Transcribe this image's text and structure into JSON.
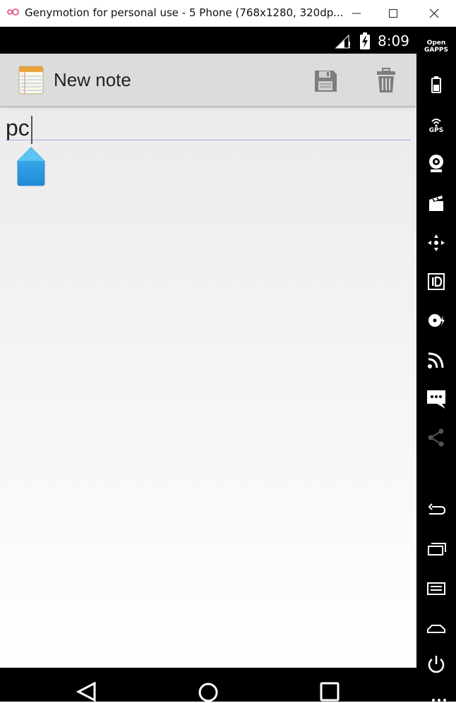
{
  "window": {
    "title": "Genymotion for personal use - 5 Phone (768x1280, 320dp...",
    "minimize_icon": "minimize-icon",
    "maximize_icon": "maximize-icon",
    "close_icon": "close-icon"
  },
  "status_bar": {
    "time": "8:09",
    "signal_icon": "signal-icon",
    "battery_icon": "battery-charging-icon"
  },
  "action_bar": {
    "title": "New note",
    "app_icon": "notepad-icon",
    "save_icon": "save-icon",
    "delete_icon": "trash-icon"
  },
  "editor": {
    "text": "pc",
    "underline_color": "#a9a9e8",
    "handle_color": "#2a9be0"
  },
  "nav_bar": {
    "back_icon": "back-icon",
    "home_icon": "home-icon",
    "recents_icon": "recents-icon"
  },
  "side_panel": {
    "open_gapps_line1": "Open",
    "open_gapps_line2": "GAPPS",
    "gps_label": "GPS",
    "items": [
      "battery-icon",
      "gps-icon",
      "webcam-icon",
      "screencast-icon",
      "dpad-icon",
      "device-id-icon",
      "disk-io-icon",
      "network-icon",
      "sms-icon",
      "share-icon",
      "back-icon",
      "recents-icon",
      "menu-icon",
      "home-icon",
      "power-icon"
    ]
  },
  "colors": {
    "action_bar": "#dcdcdc",
    "accent_blue": "#2a9be0"
  }
}
